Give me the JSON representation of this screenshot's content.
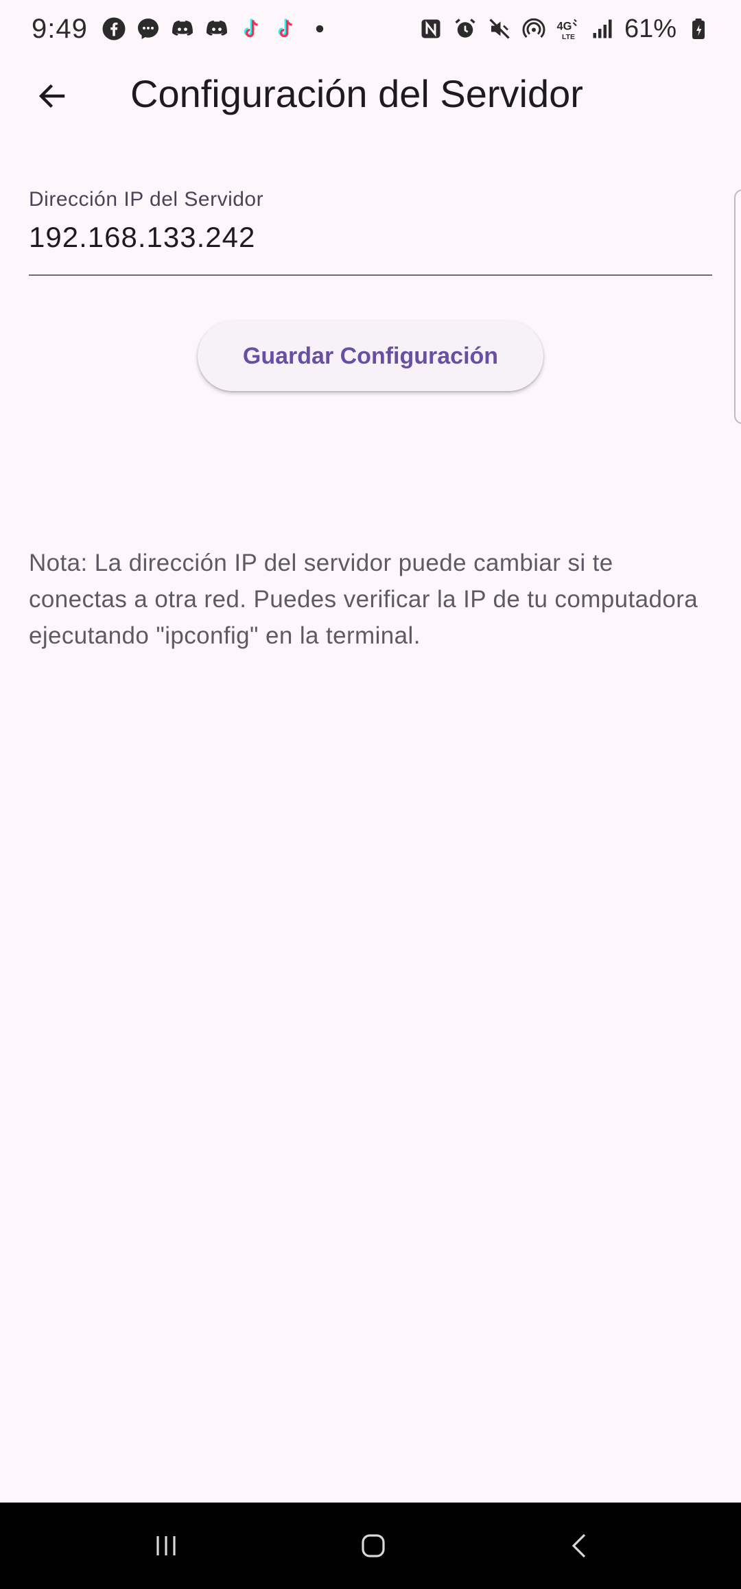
{
  "status_bar": {
    "time": "9:49",
    "notification_icons": [
      "facebook-icon",
      "messenger-icon",
      "discord-icon",
      "discord-icon",
      "tiktok-icon",
      "tiktok-icon",
      "dot-icon"
    ],
    "system_icons": [
      "nfc-icon",
      "alarm-icon",
      "mute-icon",
      "hotspot-icon",
      "4g-lte-icon",
      "signal-icon",
      "battery-icon"
    ],
    "battery": "61%"
  },
  "app_bar": {
    "title": "Configuración del Servidor",
    "back_icon": "arrow-back-icon"
  },
  "form": {
    "ip_label": "Dirección IP del Servidor",
    "ip_value": "192.168.133.242",
    "save_label": "Guardar Configuración"
  },
  "note": "Nota: La dirección IP del servidor puede cambiar si te conectas a otra red. Puedes verificar la IP de tu computadora ejecutando \"ipconfig\" en la terminal.",
  "nav_bar": {
    "buttons": [
      "recents-icon",
      "home-icon",
      "back-icon"
    ]
  },
  "colors": {
    "background": "#fdf7fc",
    "accent": "#6750a4",
    "button_bg": "#f6f2f8",
    "nav_bg": "#000000"
  }
}
